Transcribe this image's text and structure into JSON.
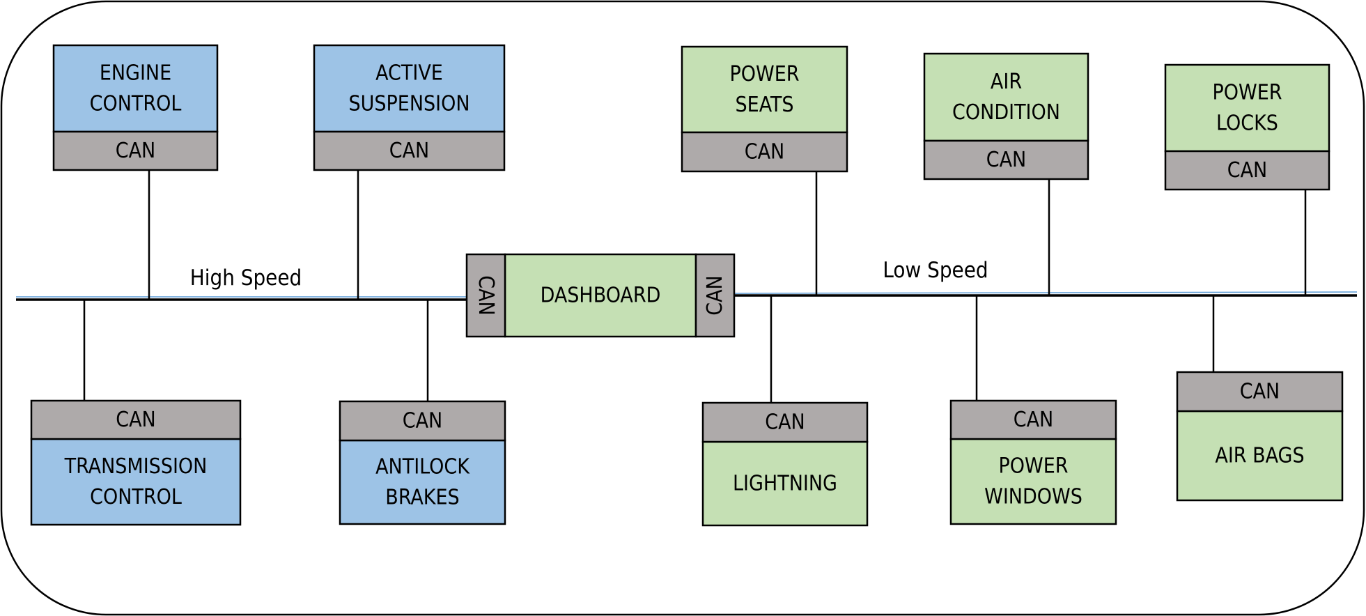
{
  "colors": {
    "high_speed_fill": "#9dc3e6",
    "low_speed_fill": "#c5e0b4",
    "can_fill": "#aeaaaa",
    "bus_line": "#000000",
    "bus_accent": "#5b9bd5",
    "border": "#000000"
  },
  "buses": {
    "high": {
      "label": "High Speed"
    },
    "low": {
      "label": "Low Speed"
    }
  },
  "dashboard": {
    "label": "DASHBOARD",
    "can_left": "CAN",
    "can_right": "CAN"
  },
  "nodes": [
    {
      "id": "engine-control",
      "lines": [
        "ENGINE",
        "CONTROL"
      ],
      "can": "CAN",
      "bus": "high",
      "side": "top"
    },
    {
      "id": "active-suspension",
      "lines": [
        "ACTIVE",
        "SUSPENSION"
      ],
      "can": "CAN",
      "bus": "high",
      "side": "top"
    },
    {
      "id": "transmission-control",
      "lines": [
        "TRANSMISSION",
        "CONTROL"
      ],
      "can": "CAN",
      "bus": "high",
      "side": "bottom"
    },
    {
      "id": "antilock-brakes",
      "lines": [
        "ANTILOCK",
        "BRAKES"
      ],
      "can": "CAN",
      "bus": "high",
      "side": "bottom"
    },
    {
      "id": "power-seats",
      "lines": [
        "POWER",
        "SEATS"
      ],
      "can": "CAN",
      "bus": "low",
      "side": "top"
    },
    {
      "id": "air-condition",
      "lines": [
        "AIR",
        "CONDITION"
      ],
      "can": "CAN",
      "bus": "low",
      "side": "top"
    },
    {
      "id": "power-locks",
      "lines": [
        "POWER",
        "LOCKS"
      ],
      "can": "CAN",
      "bus": "low",
      "side": "top"
    },
    {
      "id": "lightning",
      "lines": [
        "LIGHTNING"
      ],
      "can": "CAN",
      "bus": "low",
      "side": "bottom"
    },
    {
      "id": "power-windows",
      "lines": [
        "POWER",
        "WINDOWS"
      ],
      "can": "CAN",
      "bus": "low",
      "side": "bottom"
    },
    {
      "id": "air-bags",
      "lines": [
        "AIR BAGS"
      ],
      "can": "CAN",
      "bus": "low",
      "side": "bottom"
    }
  ]
}
